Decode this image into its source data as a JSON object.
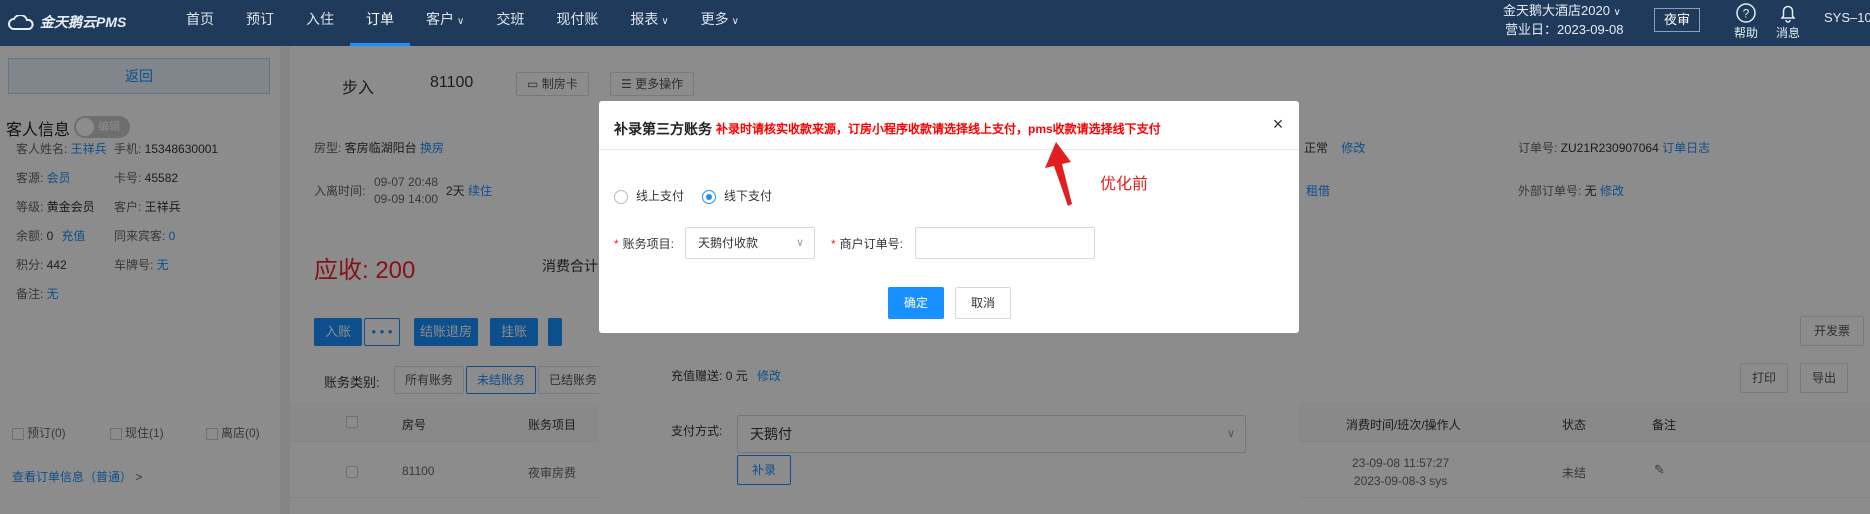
{
  "topbar": {
    "logo": "金天鹅云PMS",
    "nav": [
      {
        "label": "首页",
        "caret": false
      },
      {
        "label": "预订",
        "caret": false
      },
      {
        "label": "入住",
        "caret": false
      },
      {
        "label": "订单",
        "caret": false,
        "active": true
      },
      {
        "label": "客户",
        "caret": true
      },
      {
        "label": "交班",
        "caret": false
      },
      {
        "label": "现付账",
        "caret": false
      },
      {
        "label": "报表",
        "caret": true
      },
      {
        "label": "更多",
        "caret": true
      }
    ],
    "hotel_name": "金天鹅大酒店2020",
    "business_date": "营业日：2023-09-08",
    "night_audit": "夜审",
    "help": "帮助",
    "message": "消息",
    "user": "SYS–10"
  },
  "left": {
    "back": "返回",
    "guest_info": "客人信息",
    "toggle_text": "编辑",
    "fields": [
      {
        "label": "客人姓名: ",
        "value": "王祥兵",
        "link": true
      },
      {
        "label": "手机: ",
        "value": "15348630001",
        "link": false
      },
      {
        "label": "客源: ",
        "value": "会员",
        "link": true
      },
      {
        "label": "卡号: ",
        "value": "45582",
        "link": false
      },
      {
        "label": "等级: ",
        "value": "黄金会员",
        "link": false
      },
      {
        "label": "客户: ",
        "value": "王祥兵",
        "link": false
      },
      {
        "label": "余额: ",
        "value": "0",
        "link": false,
        "extra": "充值"
      },
      {
        "label": "同来宾客: ",
        "value": "0",
        "link": true
      },
      {
        "label": "积分: ",
        "value": "442",
        "link": false
      },
      {
        "label": "车牌号: ",
        "value": "无",
        "link": true
      },
      {
        "label": "备注: ",
        "value": "无",
        "link": true
      }
    ],
    "checks": [
      "预订(0)",
      "现住(1)",
      "离店(0)"
    ],
    "order_info": "查看订单信息（普通）",
    "order_info_arrow": ">"
  },
  "main": {
    "status": "步入",
    "room": "81100",
    "make_card": "制房卡",
    "more_ops": "更多操作",
    "room_type_label": "房型: ",
    "room_type": "客房临湖阳台",
    "change_room": "换房",
    "checkin_label": "入离时间: ",
    "checkin_time": "09-07 20:48",
    "checkout_time": "09-09 14:00",
    "nights": "2天",
    "extend": "续住",
    "status_right": "正常",
    "modify": "修改",
    "rent": "租借",
    "order_no_label": "订单号: ",
    "order_no": "ZU21R230907064",
    "order_log": "订单日志",
    "ext_order_label": "外部订单号: ",
    "ext_order": "无",
    "ext_modify": "修改",
    "receivable": "应收: 200",
    "consume_total": "消费合计",
    "btn_checkin": "入账",
    "btn_more": "• • •",
    "btn_settle": "结账退房",
    "btn_hang": "挂账",
    "invoice": "开发票",
    "print": "打印",
    "export": "导出",
    "category_label": "账务类别:",
    "categories": [
      "所有账务",
      "未结账务",
      "已结账务"
    ],
    "table_headers": [
      "房号",
      "账务项目",
      "消费时间/班次/操作人",
      "状态",
      "备注"
    ],
    "row": {
      "room": "81100",
      "item": "夜审房费",
      "time": "23-09-08 11:57:27",
      "shift": "2023-09-08-3 sys",
      "status": "未结"
    },
    "recharge_gift_label": "充值赠送:",
    "recharge_gift_value": "0 元",
    "recharge_modify": "修改",
    "pay_method_label": "支付方式:",
    "pay_method_value": "天鹅付",
    "supplement": "补录"
  },
  "modal": {
    "title": "补录第三方账务",
    "warning": "补录时请核实收款来源，订房小程序收款请选择线上支付，pms收款请选择线下支付",
    "close": "×",
    "online_pay": "线上支付",
    "offline_pay": "线下支付",
    "account_item_label": "账务项目:",
    "account_item_value": "天鹅付收款",
    "merchant_order_label": "商户订单号:",
    "merchant_order_value": "",
    "confirm": "确定",
    "cancel": "取消"
  },
  "annotation": "优化前",
  "colors": {
    "primary": "#1890ff",
    "warning": "#ff0000",
    "topbar": "#1f3a5a"
  }
}
